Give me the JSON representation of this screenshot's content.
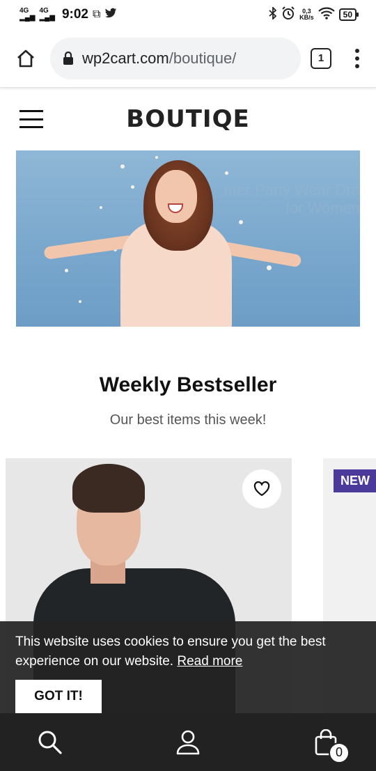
{
  "status_bar": {
    "signal1": "4G",
    "signal2": "4G",
    "time": "9:02",
    "speed_value": "0,3",
    "speed_unit": "KB/s",
    "battery": "50"
  },
  "browser": {
    "url_domain": "wp2cart.com",
    "url_path": "/boutique/",
    "tab_count": "1"
  },
  "site": {
    "logo": "BOUTIQE"
  },
  "hero": {
    "line1": "mer Party Wear Dre",
    "line2": "for Women"
  },
  "section": {
    "title": "Weekly Bestseller",
    "subtitle": "Our best items this week!"
  },
  "products": [
    {
      "badge": ""
    },
    {
      "badge": "NEW"
    }
  ],
  "cookie": {
    "message": "This website uses cookies to ensure you get the best experience on our website.",
    "link_label": "Read more",
    "button_label": "GOT IT!"
  },
  "bottom_nav": {
    "cart_count": "0"
  }
}
